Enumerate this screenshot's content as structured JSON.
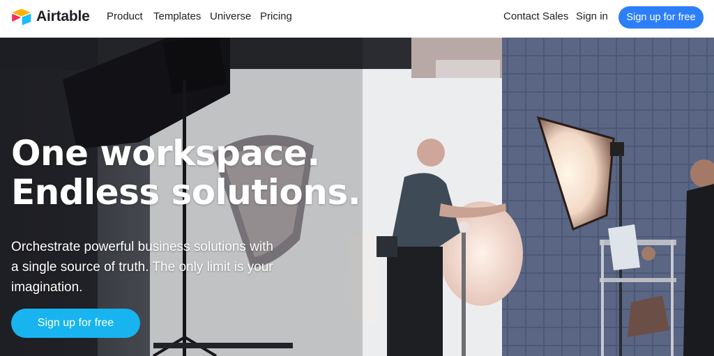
{
  "nav": {
    "brand": "Airtable",
    "links": [
      "Product",
      "Templates",
      "Universe",
      "Pricing"
    ],
    "contact_sales": "Contact Sales",
    "sign_in": "Sign in",
    "signup_label": "Sign up for free"
  },
  "hero": {
    "headline_line1": "One workspace.",
    "headline_line2": "Endless solutions.",
    "subhead": "Orchestrate powerful business solutions with a single source of truth. The only limit is your imagination.",
    "cta_label": "Sign up for free",
    "image": "photo-studio-background"
  },
  "colors": {
    "primary_blue": "#2d7ff9",
    "cta_blue": "#18b4f0",
    "logo_yellow": "#fcb400",
    "logo_red": "#f82b60",
    "logo_blue": "#18bfff",
    "text_dark": "#1d1f25"
  }
}
